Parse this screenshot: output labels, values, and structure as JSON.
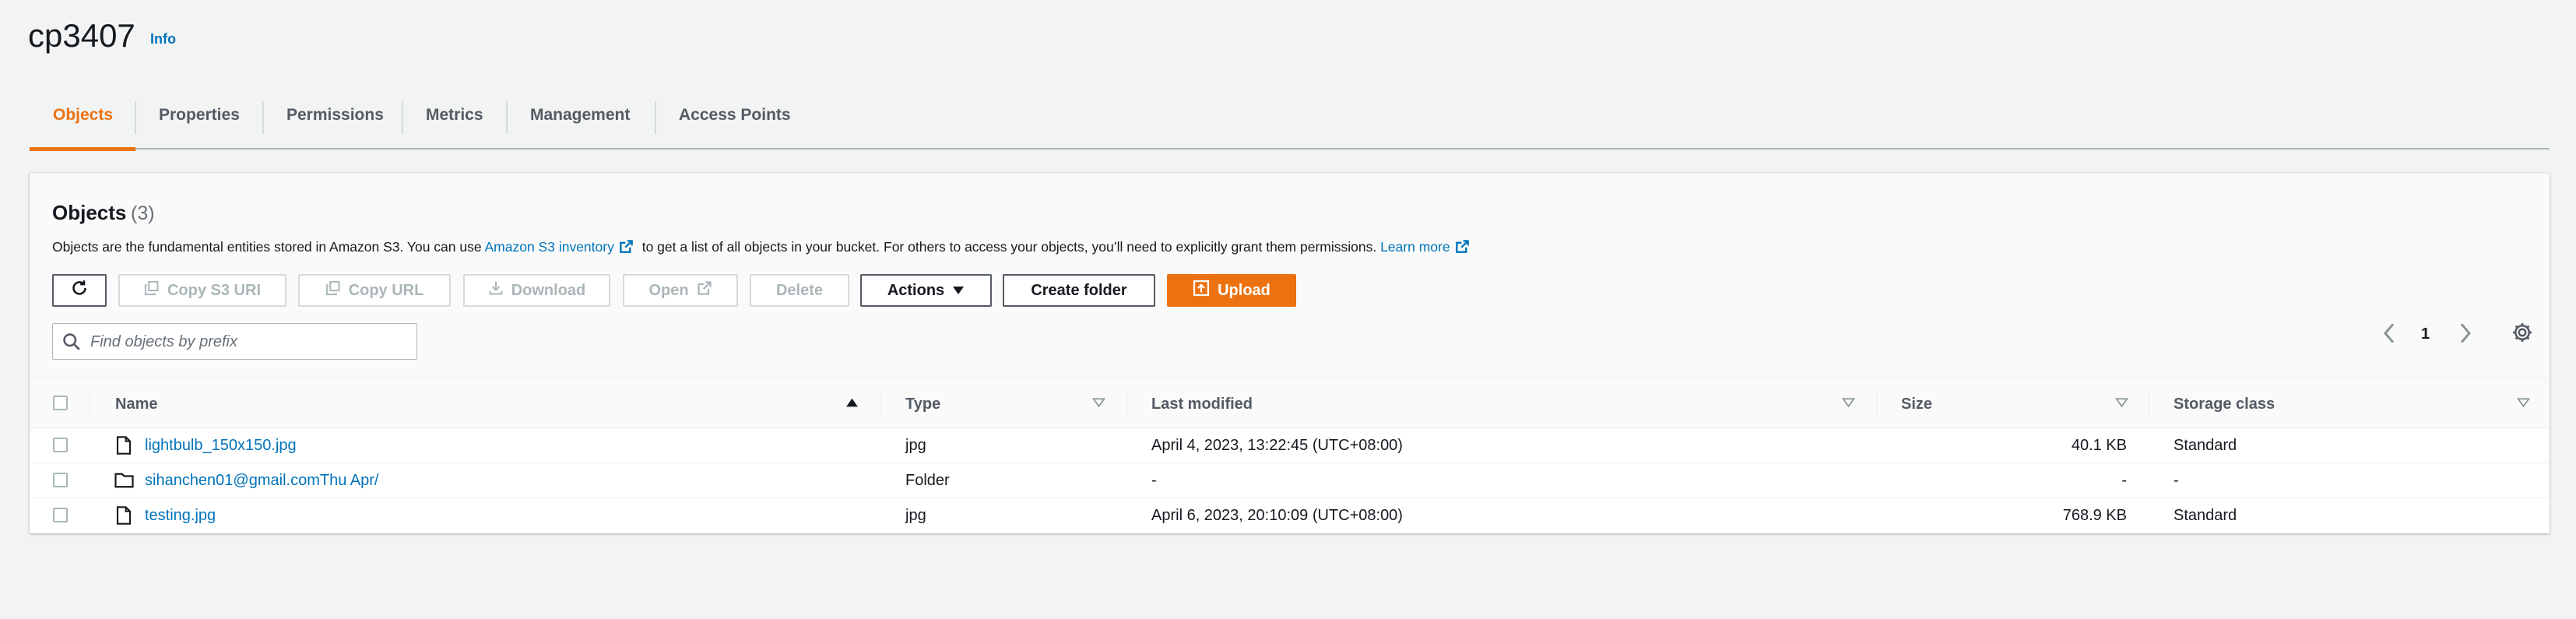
{
  "bucket": {
    "name": "cp3407",
    "info_label": "Info"
  },
  "tabs": [
    {
      "label": "Objects"
    },
    {
      "label": "Properties"
    },
    {
      "label": "Permissions"
    },
    {
      "label": "Metrics"
    },
    {
      "label": "Management"
    },
    {
      "label": "Access Points"
    }
  ],
  "active_tab": "Objects",
  "objects_panel": {
    "title": "Objects",
    "count": "(3)",
    "description": {
      "part1": "Objects are the fundamental entities stored in Amazon S3. You can use ",
      "link1": "Amazon S3 inventory",
      "part2": " to get a list of all objects in your bucket. For others to access your objects, you’ll need to explicitly grant them permissions. ",
      "link2": "Learn more"
    },
    "toolbar": {
      "refresh_icon": "refresh-icon",
      "copy_s3_uri": "Copy S3 URI",
      "copy_url": "Copy URL",
      "download": "Download",
      "open": "Open",
      "delete": "Delete",
      "actions": "Actions",
      "create_folder": "Create folder",
      "upload": "Upload"
    },
    "search": {
      "placeholder": "Find objects by prefix",
      "value": ""
    },
    "pagination": {
      "current_page": "1"
    }
  },
  "table": {
    "columns": [
      "Name",
      "Type",
      "Last modified",
      "Size",
      "Storage class"
    ],
    "rows": [
      {
        "name": "lightbulb_150x150.jpg",
        "icon": "file-icon",
        "type": "jpg",
        "last_modified": "April 4, 2023, 13:22:45 (UTC+08:00)",
        "size": "40.1 KB",
        "storage_class": "Standard"
      },
      {
        "name": "sihanchen01@gmail.comThu Apr/",
        "icon": "folder-icon",
        "type": "Folder",
        "last_modified": "-",
        "size": "-",
        "storage_class": "-"
      },
      {
        "name": "testing.jpg",
        "icon": "file-icon",
        "type": "jpg",
        "last_modified": "April 6, 2023, 20:10:09 (UTC+08:00)",
        "size": "768.9 KB",
        "storage_class": "Standard"
      }
    ]
  },
  "colors": {
    "accent": "#ec7211",
    "link": "#0073bb",
    "text": "#16191f",
    "muted": "#545b64",
    "background": "#f2f3f3"
  }
}
